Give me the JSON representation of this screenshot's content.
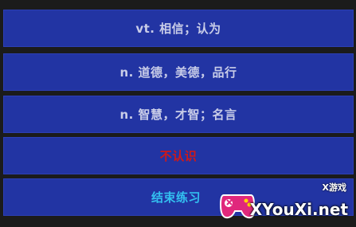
{
  "options": [
    {
      "label": "vt. 相信；认为"
    },
    {
      "label": "n. 道德，美德，品行"
    },
    {
      "label": "n. 智慧，才智；名言"
    }
  ],
  "unknown_label": "不认识",
  "finish_label": "结束练习",
  "colors": {
    "button_bg": "#2234a3",
    "option_text": "#c9cde8",
    "unknown_text": "#d01818",
    "finish_text": "#33c0f0",
    "background": "#1b1b1b"
  },
  "watermark": {
    "tag": "X游戏",
    "brand": "XYouXi.net"
  }
}
